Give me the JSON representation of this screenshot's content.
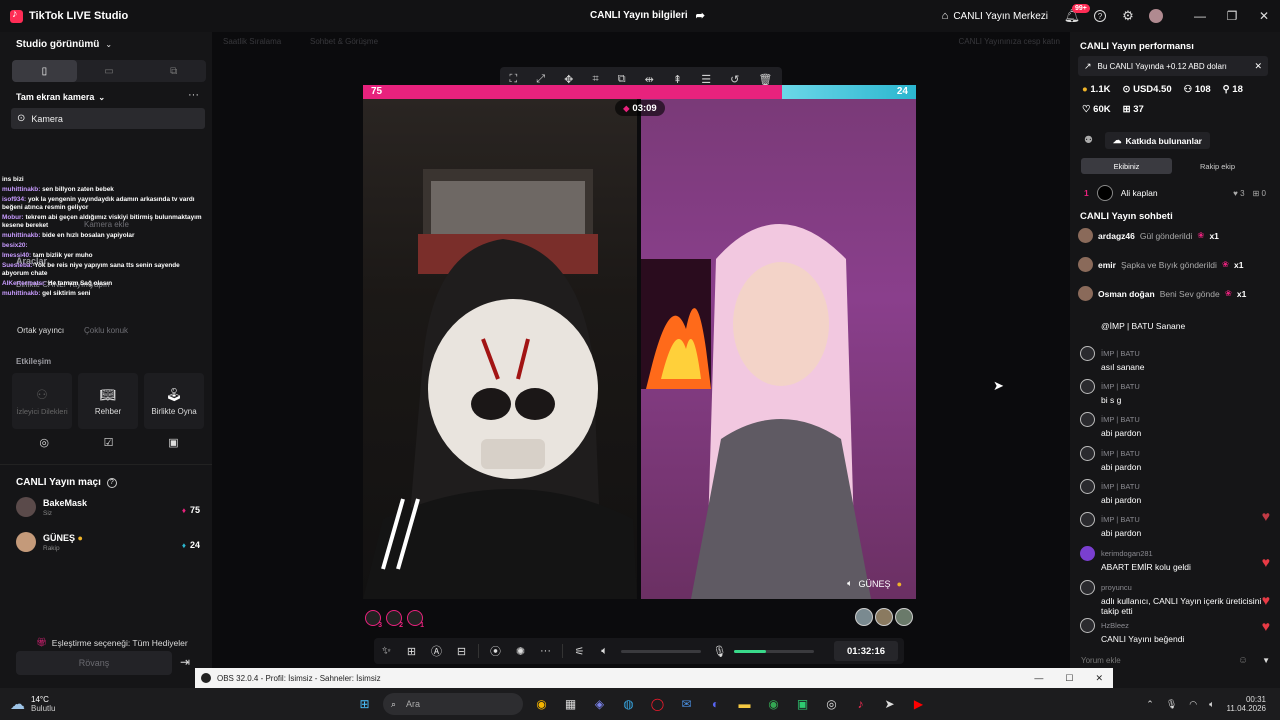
{
  "titlebar": {
    "app_name": "TikTok LIVE Studio",
    "center_title": "CANLI Yayın bilgileri",
    "center_right": "CANLI Yayın Merkezi",
    "notif_badge": "99+"
  },
  "left": {
    "studio_view": "Studio görünümü",
    "scene_name": "Tam ekran kamera",
    "camera_source": "Camera_label_placeholder",
    "camera_label": "Kamera",
    "chat_lines": [
      {
        "user": "",
        "text": "ins bizi"
      },
      {
        "user": "muhittinakb:",
        "text": "sen billyon zaten bebek"
      },
      {
        "user": "isof934:",
        "text": "yok la yengenin yayındaydık adamın arkasında tv vardı beğeni atınca resmin geliyor"
      },
      {
        "user": "Mobur:",
        "text": "tekrem abi geçen aldığımız viskiyi bitirmiş bulunmaktayım kesene bereket"
      },
      {
        "user": "muhittinakb:",
        "text": "bide en hızlı bosalan yapiyolar"
      },
      {
        "user": "besix20:",
        "text": ""
      },
      {
        "user": "Imessi40:",
        "text": "tam bizlik yer muho"
      },
      {
        "user": "Suesteba:",
        "text": "Yok be reis niye yapıyım sana tts senin sayende abyorum chate"
      },
      {
        "user": "AlKertermatsı:",
        "text": "He tamam Sağ olasın"
      },
      {
        "user": "muhittinakb:",
        "text": "gel siktirim seni"
      }
    ],
    "ghost_texts": {
      "kamera_ekle": "Kamera ekle",
      "araclar": "Araçlar",
      "birlikte_yayin": "Birlikte CANLI Yayın yapın",
      "ortak_yayinci": "Ortak yayıncı",
      "coklu_konuk": "Çoklu konuk"
    },
    "etkilesim": "Etkileşim",
    "tools": [
      {
        "label": "İzleyici Dilekleri",
        "icon": "person-icon"
      },
      {
        "label": "Rehber",
        "icon": "book-icon"
      },
      {
        "label": "Birlikte Oyna",
        "icon": "joystick-icon"
      }
    ],
    "battle_title": "CANLI Yayın maçı",
    "players": [
      {
        "name": "BakeMask",
        "sub": "Siz",
        "score": "75"
      },
      {
        "name": "GÜNEŞ",
        "sub": "Rakip",
        "score": "24"
      }
    ],
    "matching_option": "Eşleştirme seçeneği: Tüm Hediyeler",
    "rematch": "Rövanş"
  },
  "center": {
    "ghost_top_left": "Saatlik Sıralama",
    "ghost_top_mid": "Sohbet & Görüşme",
    "ghost_top_right": "CANLI Yayınınıza cesp katın",
    "score_left": "75",
    "score_right": "24",
    "timer": "03:09",
    "right_name": "GÜNEŞ",
    "ranks": [
      "3",
      "2",
      "1"
    ],
    "elapsed": "01:32:16",
    "volume_level": 0.0,
    "mic_level": 0.4
  },
  "right": {
    "perf_title": "CANLI Yayın performansı",
    "notice": "Bu CANLI Yayında +0.12 ABD doları",
    "stat_coins": "1.1K",
    "stat_usd": "USD4.50",
    "stat_viewers": "108",
    "stat_new": "18",
    "stat_likes": "60K",
    "stat_gifts": "37",
    "contributors": "Katkıda bulunanlar",
    "tab_ours": "Ekibiniz",
    "tab_rival": "Rakip ekip",
    "top_contrib": {
      "rank": "1",
      "name": "Ali kaplan",
      "likes": "3",
      "gifts": "0"
    },
    "chat_title": "CANLI Yayın sohbeti",
    "gifts": [
      {
        "user": "ardagz46",
        "text": "Gül gönderildi",
        "count": "x1"
      },
      {
        "user": "emir",
        "text": "Şapka ve Bıyık gönderildi",
        "count": "x1"
      },
      {
        "user": "Osman doğan",
        "text": "Beni Sev gönde",
        "count": "x1"
      }
    ],
    "messages": [
      {
        "user": "",
        "text": "@İMP | BATU Sanane"
      },
      {
        "user": "İMP | BATU",
        "text": "asıl sanane"
      },
      {
        "user": "İMP | BATU",
        "text": "bi s g"
      },
      {
        "user": "İMP | BATU",
        "text": "abi pardon"
      },
      {
        "user": "İMP | BATU",
        "text": "abi pardon"
      },
      {
        "user": "İMP | BATU",
        "text": "abi pardon"
      },
      {
        "user": "İMP | BATU",
        "text": "abi pardon"
      },
      {
        "user": "kerimdogan281",
        "text": "ABART EMİR kolu geldi"
      },
      {
        "user": "proyuncu",
        "text": "adlı kullanıcı, CANLI Yayın içerik üreticisini takip etti"
      },
      {
        "user": "HzBleez",
        "text": "CANLI Yayını beğendi"
      }
    ],
    "comment_placeholder": "Yorum ekle"
  },
  "obs": {
    "title": "OBS 32.0.4 - Profil: İsimsiz - Sahneler: İsimsiz"
  },
  "taskbar": {
    "weather_temp": "14°C",
    "weather_desc": "Bulutlu",
    "search": "Ara",
    "time": "00:31",
    "date": "11.04.2026"
  },
  "colors": {
    "pink": "#e8227d",
    "blue": "#2bb6cf",
    "green": "#39d98a",
    "heart": "#e83a45"
  }
}
